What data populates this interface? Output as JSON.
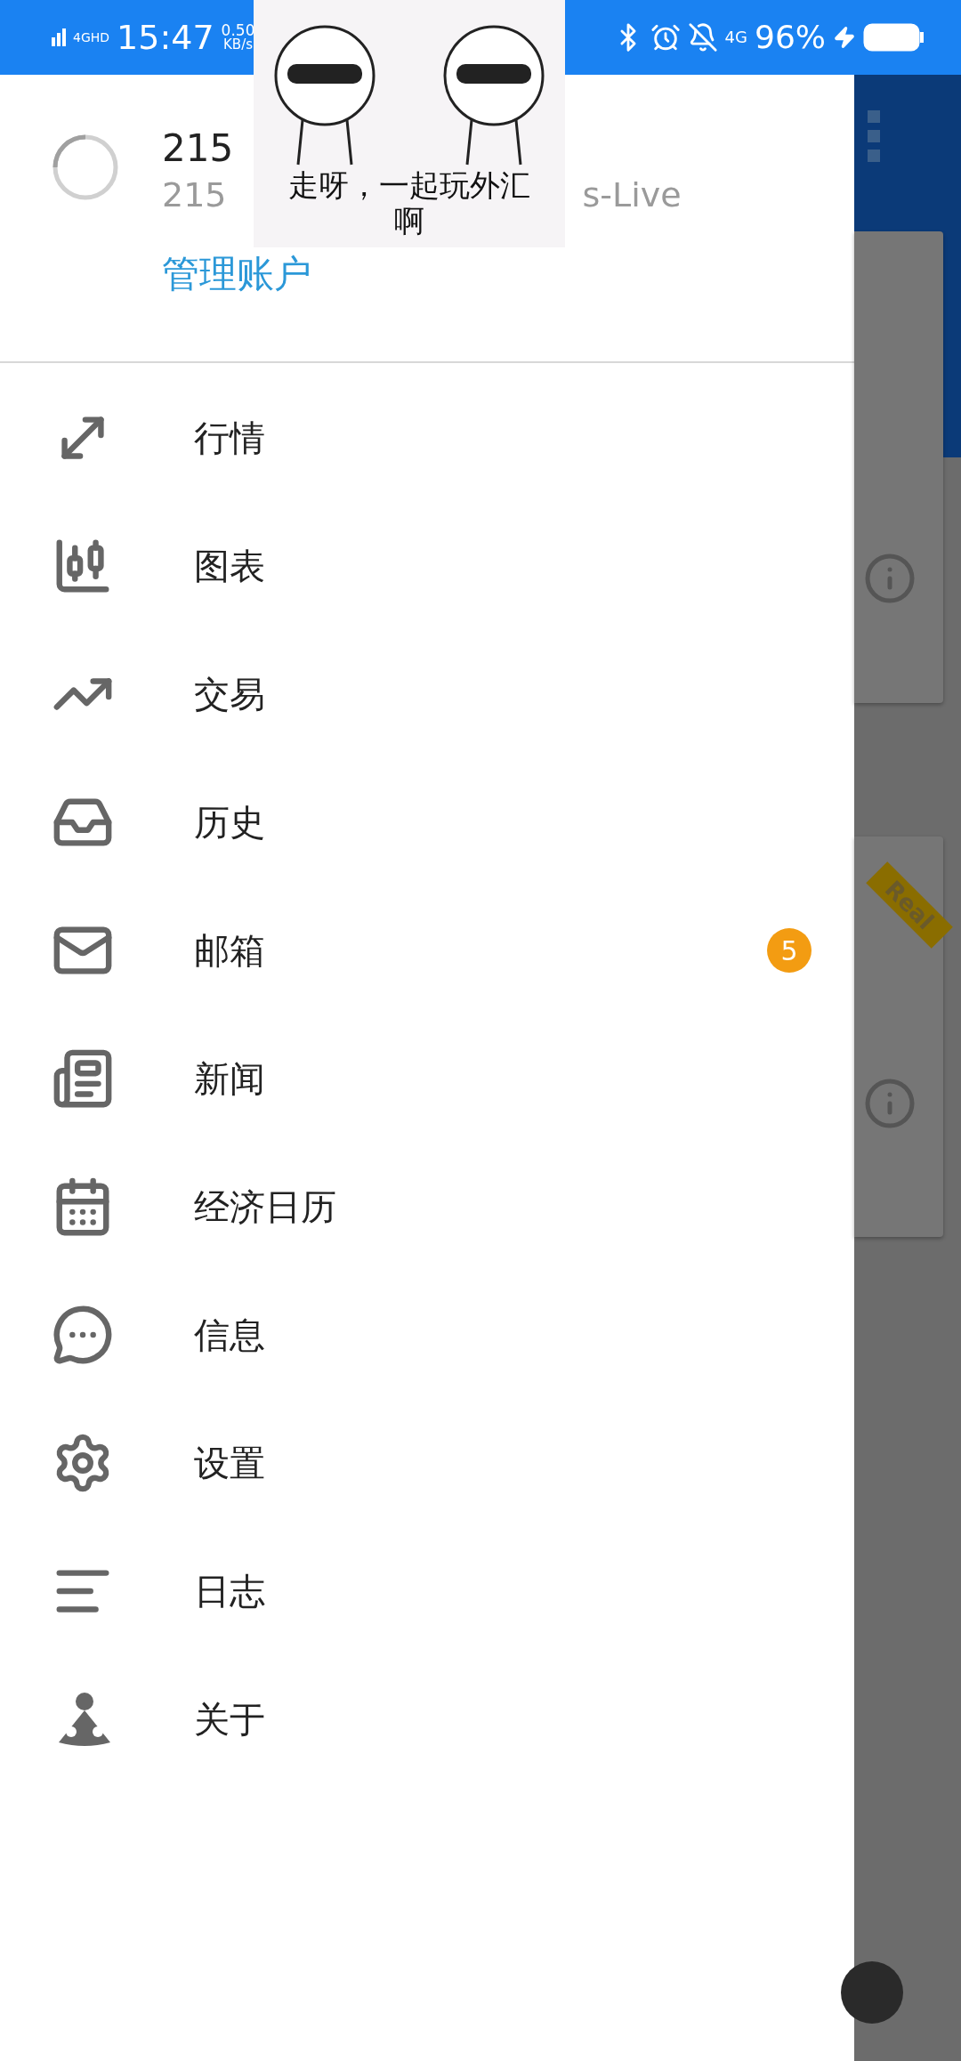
{
  "status_bar": {
    "network": "4GHD",
    "time": "15:47",
    "speed_value": "0.50",
    "speed_unit": "KB/s",
    "mobile_data": "4G",
    "battery": "96%"
  },
  "sticker": {
    "caption": "走呀，一起玩外汇啊"
  },
  "drawer": {
    "account": {
      "name": "215",
      "server_start": "215",
      "server_end": "s-Live",
      "manage_link": "管理账户"
    },
    "items": [
      {
        "label": "行情"
      },
      {
        "label": "图表"
      },
      {
        "label": "交易"
      },
      {
        "label": "历史"
      },
      {
        "label": "邮箱",
        "badge": "5"
      },
      {
        "label": "新闻"
      },
      {
        "label": "经济日历"
      },
      {
        "label": "信息"
      },
      {
        "label": "设置"
      },
      {
        "label": "日志"
      },
      {
        "label": "关于"
      }
    ]
  },
  "background": {
    "ribbon": "Real"
  }
}
